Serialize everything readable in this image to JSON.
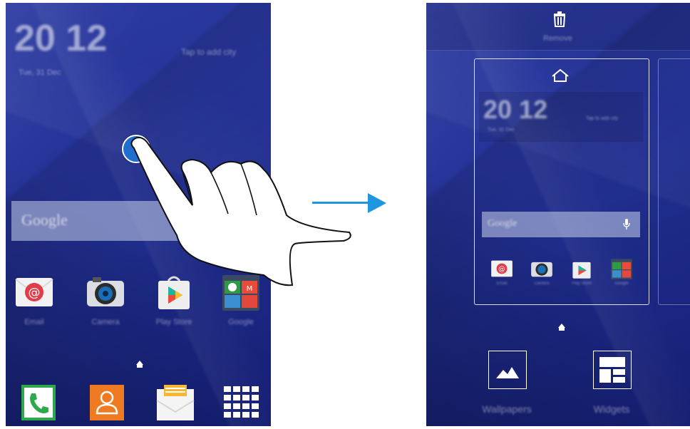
{
  "left_screen": {
    "clock": {
      "time": "20 12",
      "date": "Tue, 31 Dec",
      "add_city": "Tap to add city"
    },
    "search": {
      "label": "Google"
    },
    "apps": [
      {
        "name": "email-icon",
        "label": "Email"
      },
      {
        "name": "camera-icon",
        "label": "Camera"
      },
      {
        "name": "play-store-icon",
        "label": "Play Store"
      },
      {
        "name": "google-folder-icon",
        "label": "Google"
      }
    ],
    "dock": [
      {
        "name": "phone-icon"
      },
      {
        "name": "contacts-icon"
      },
      {
        "name": "messages-icon"
      },
      {
        "name": "apps-grid-icon"
      }
    ]
  },
  "right_screen": {
    "remove_label": "Remove",
    "preview": {
      "clock": {
        "time": "20 12",
        "date": "Tue, 31 Dec",
        "add_city": "Tap to add city"
      },
      "search": {
        "label": "Google"
      },
      "apps": [
        {
          "name": "email-icon",
          "label": "Email"
        },
        {
          "name": "camera-icon",
          "label": "Camera"
        },
        {
          "name": "play-store-icon",
          "label": "Play Store"
        },
        {
          "name": "google-folder-icon",
          "label": "Google"
        }
      ]
    },
    "options": [
      {
        "name": "wallpapers-option",
        "label": "Wallpapers"
      },
      {
        "name": "widgets-option",
        "label": "Widgets"
      }
    ]
  },
  "colors": {
    "accent": "#1e96e0",
    "wallpaper": "#26349a"
  }
}
